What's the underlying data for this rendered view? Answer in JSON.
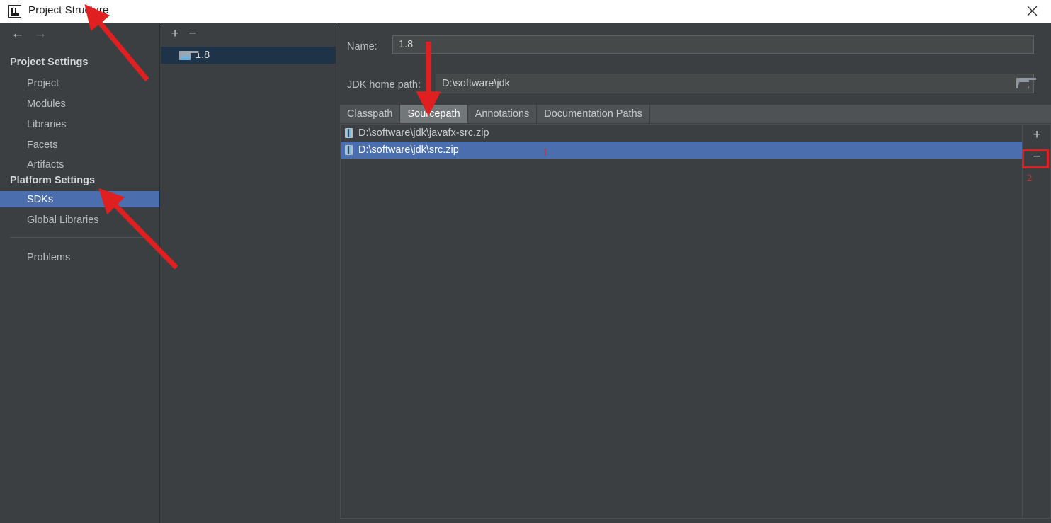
{
  "window": {
    "title": "Project Structure",
    "app_icon": "intellij-idea-icon",
    "close_icon": "close-icon"
  },
  "sidebar": {
    "back_icon": "arrow-left-icon",
    "forward_icon": "arrow-right-icon",
    "groups": [
      {
        "label": "Project Settings",
        "items": [
          {
            "label": "Project",
            "selected": false
          },
          {
            "label": "Modules",
            "selected": false
          },
          {
            "label": "Libraries",
            "selected": false
          },
          {
            "label": "Facets",
            "selected": false
          },
          {
            "label": "Artifacts",
            "selected": false
          }
        ]
      },
      {
        "label": "Platform Settings",
        "items": [
          {
            "label": "SDKs",
            "selected": true
          },
          {
            "label": "Global Libraries",
            "selected": false
          }
        ]
      }
    ],
    "extra_items": [
      {
        "label": "Problems",
        "selected": false
      }
    ]
  },
  "tree_panel": {
    "add_label": "+",
    "remove_label": "−",
    "add_icon": "plus-icon",
    "remove_icon": "minus-icon",
    "items": [
      {
        "label": "1.8",
        "icon": "folder-icon",
        "selected": true
      }
    ]
  },
  "sdk_editor": {
    "name_label": "Name:",
    "name_value": "1.8",
    "jdk_home_label": "JDK home path:",
    "jdk_home_value": "D:\\software\\jdk",
    "browse_icon": "folder-browse-icon",
    "tabs": [
      {
        "label": "Classpath",
        "active": false
      },
      {
        "label": "Sourcepath",
        "active": true
      },
      {
        "label": "Annotations",
        "active": false
      },
      {
        "label": "Documentation Paths",
        "active": false
      }
    ],
    "paths": [
      {
        "label": "D:\\software\\jdk\\javafx-src.zip",
        "icon": "zip-file-icon",
        "selected": false
      },
      {
        "label": "D:\\software\\jdk\\src.zip",
        "icon": "zip-file-icon",
        "selected": true
      }
    ],
    "add_label": "+",
    "remove_label": "−",
    "add_icon": "plus-icon",
    "remove_icon": "minus-icon"
  },
  "annotations": {
    "step_one": "1",
    "step_two": "2",
    "accent_color": "#e02020"
  }
}
